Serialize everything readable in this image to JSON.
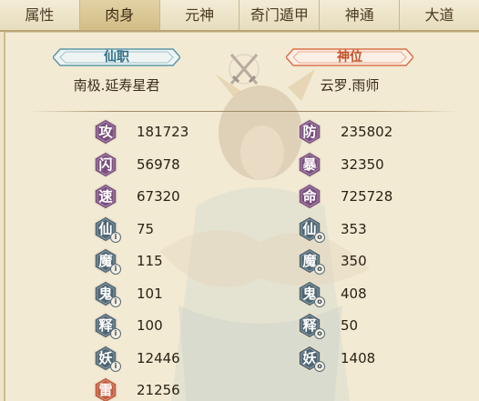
{
  "tabs": [
    {
      "label": "属性",
      "active": false
    },
    {
      "label": "肉身",
      "active": true
    },
    {
      "label": "元神",
      "active": false
    },
    {
      "label": "奇门遁甲",
      "active": false
    },
    {
      "label": "神通",
      "active": false
    },
    {
      "label": "大道",
      "active": false
    }
  ],
  "header": {
    "left_banner": "仙职",
    "left_title": "南极.延寿星君",
    "right_banner": "神位",
    "right_title": "云罗.雨师",
    "center_icon": "crossed-swords-icon"
  },
  "stats_left": [
    {
      "glyph": "攻",
      "value": "181723",
      "badge": "",
      "color": "#7a4f7e"
    },
    {
      "glyph": "闪",
      "value": "56978",
      "badge": "",
      "color": "#7a4f7e"
    },
    {
      "glyph": "速",
      "value": "67320",
      "badge": "",
      "color": "#7a4f7e"
    },
    {
      "glyph": "仙",
      "value": "75",
      "badge": "i",
      "color": "#4f6673"
    },
    {
      "glyph": "魔",
      "value": "115",
      "badge": "i",
      "color": "#4f6673"
    },
    {
      "glyph": "鬼",
      "value": "101",
      "badge": "i",
      "color": "#4f6673"
    },
    {
      "glyph": "释",
      "value": "100",
      "badge": "i",
      "color": "#4f6673"
    },
    {
      "glyph": "妖",
      "value": "12446",
      "badge": "i",
      "color": "#4f6673"
    },
    {
      "glyph": "雷",
      "value": "21256",
      "badge": "",
      "color": "#c25a3c"
    }
  ],
  "stats_right": [
    {
      "glyph": "防",
      "value": "235802",
      "badge": "",
      "color": "#7a4f7e"
    },
    {
      "glyph": "暴",
      "value": "32350",
      "badge": "",
      "color": "#7a4f7e"
    },
    {
      "glyph": "命",
      "value": "725728",
      "badge": "",
      "color": "#7a4f7e"
    },
    {
      "glyph": "仙",
      "value": "353",
      "badge": "o",
      "color": "#4f6673"
    },
    {
      "glyph": "魔",
      "value": "350",
      "badge": "o",
      "color": "#4f6673"
    },
    {
      "glyph": "鬼",
      "value": "408",
      "badge": "o",
      "color": "#4f6673"
    },
    {
      "glyph": "释",
      "value": "50",
      "badge": "o",
      "color": "#4f6673"
    },
    {
      "glyph": "妖",
      "value": "1408",
      "badge": "o",
      "color": "#4f6673"
    }
  ],
  "colors": {
    "tab_active": "#d2bd86",
    "banner_left": "#2f6f89",
    "banner_right": "#c4532a"
  }
}
